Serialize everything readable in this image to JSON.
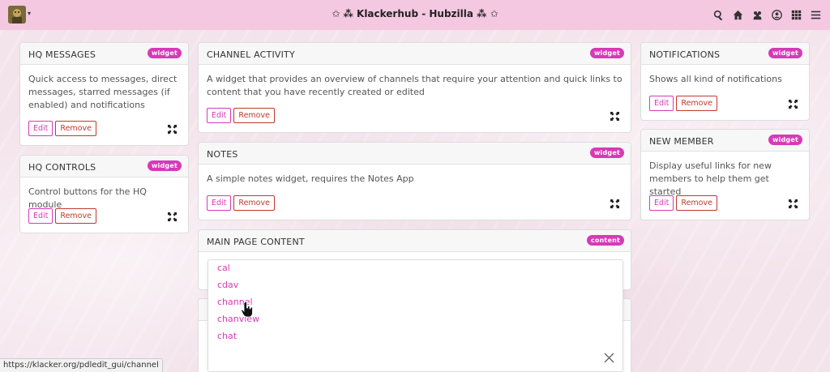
{
  "navbar": {
    "title": "✩ ⁂ Klackerhub - Hubzilla ⁂ ✩",
    "caret": "▾",
    "icons": [
      "search-icon",
      "home-icon",
      "users-icon",
      "user-circle-icon",
      "grid-icon",
      "menu-icon"
    ]
  },
  "cards": {
    "hq_messages": {
      "title": "HQ MESSAGES",
      "badge": "widget",
      "description": "Quick access to messages, direct messages, starred messages (if enabled) and notifications"
    },
    "hq_controls": {
      "title": "HQ CONTROLS",
      "badge": "widget",
      "description": "Control buttons for the HQ module"
    },
    "channel_activity": {
      "title": "CHANNEL ACTIVITY",
      "badge": "widget",
      "description": "A widget that provides an overview of channels that require your attention and quick links to content that you have recently created or edited"
    },
    "notes": {
      "title": "NOTES",
      "badge": "widget",
      "description": "A simple notes widget, requires the Notes App"
    },
    "main_page_content": {
      "title": "MAIN PAGE CONTENT",
      "badge": "content"
    },
    "notifications": {
      "title": "NOTIFICATIONS",
      "badge": "widget",
      "description": "Shows all kind of notifications"
    },
    "new_member": {
      "title": "NEW MEMBER",
      "badge": "widget",
      "description": "Display useful links for new members to help them get started"
    }
  },
  "buttons": {
    "edit": "Edit",
    "remove": "Remove"
  },
  "dropdown": {
    "items": [
      "cal",
      "cdav",
      "channel",
      "chanview",
      "chat"
    ]
  },
  "statusbar": {
    "url": "https://klacker.org/pdledit_gui/channel"
  },
  "colors": {
    "accent": "#d63ab7",
    "danger": "#c0392b",
    "navbar": "#f5c8e2"
  }
}
